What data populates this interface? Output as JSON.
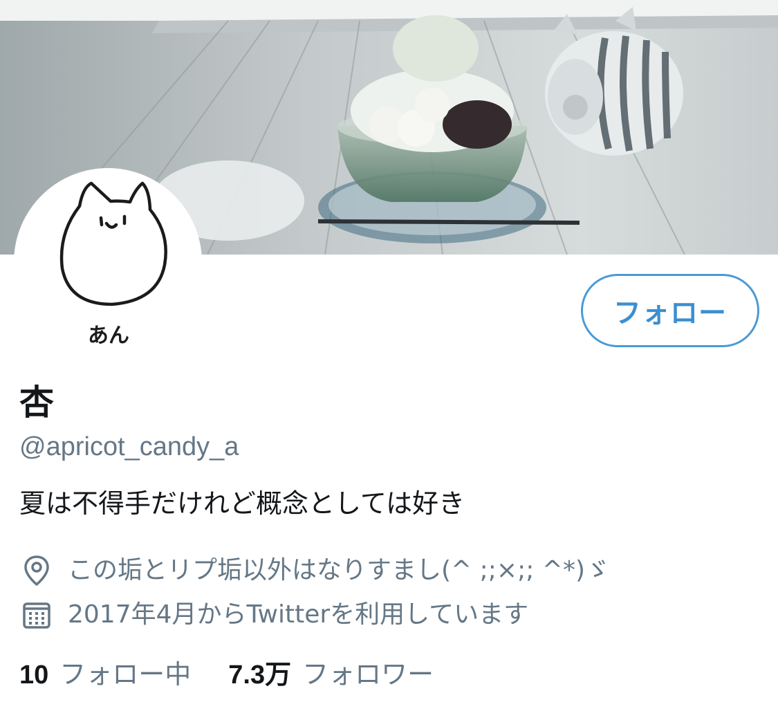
{
  "profile": {
    "display_name": "杏",
    "handle": "@apricot_candy_a",
    "bio": "夏は不得手だけれど概念としては好き",
    "location": "この垢とリプ垢以外はなりすまし(^ ;;×;; ^*)ゞ",
    "joined": "2017年4月からTwitterを利用しています",
    "avatar_caption": "あん"
  },
  "actions": {
    "follow_label": "フォロー"
  },
  "stats": {
    "following_count": "10",
    "following_label": "フォロー中",
    "followers_count": "7.3万",
    "followers_label": "フォロワー"
  },
  "icons": {
    "location": "location-pin-icon",
    "calendar": "calendar-icon"
  },
  "colors": {
    "accent": "#4a9ad6",
    "text_primary": "#14171a",
    "text_secondary": "#657786"
  }
}
